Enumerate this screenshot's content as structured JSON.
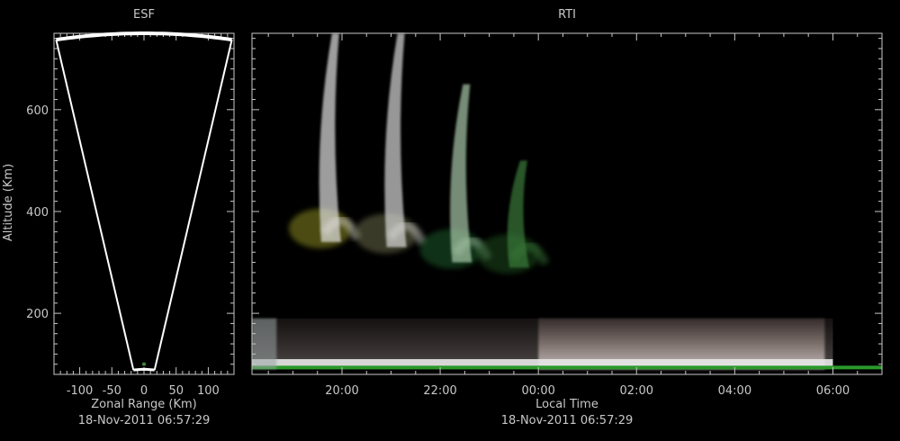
{
  "chart_data": [
    {
      "type": "heatmap",
      "title": "ESF",
      "xlabel": "Zonal Range (Km)",
      "ylabel": "Altitude (Km)",
      "timestamp": "18-Nov-2011 06:57:29",
      "xlim": [
        -140,
        140
      ],
      "ylim": [
        80,
        750
      ],
      "x_ticks": [
        -100,
        -50,
        0,
        50,
        100
      ],
      "y_ticks": [
        200,
        400,
        600
      ],
      "sector": {
        "r_min": 90,
        "r_max": 750,
        "half_angle_deg": 10.5
      }
    },
    {
      "type": "heatmap",
      "title": "RTI",
      "xlabel": "Local Time",
      "ylabel": "Altitude (Km)",
      "timestamp": "18-Nov-2011 06:57:29",
      "xlim": [
        "18:10",
        "07:00"
      ],
      "ylim": [
        80,
        750
      ],
      "x_ticks": [
        "20:00",
        "22:00",
        "00:00",
        "02:00",
        "04:00",
        "06:00"
      ],
      "y_ticks": [
        200,
        400,
        600
      ],
      "plumes": [
        {
          "time": "19:50",
          "alt_low": 340,
          "alt_high": 750
        },
        {
          "time": "21:10",
          "alt_low": 330,
          "alt_high": 750
        },
        {
          "time": "22:30",
          "alt_low": 300,
          "alt_high": 650
        },
        {
          "time": "23:40",
          "alt_low": 290,
          "alt_high": 500
        }
      ],
      "bottom_layer": {
        "time_start": "18:10",
        "time_end": "06:00",
        "alt_low": 90,
        "alt_high": 190
      }
    }
  ]
}
